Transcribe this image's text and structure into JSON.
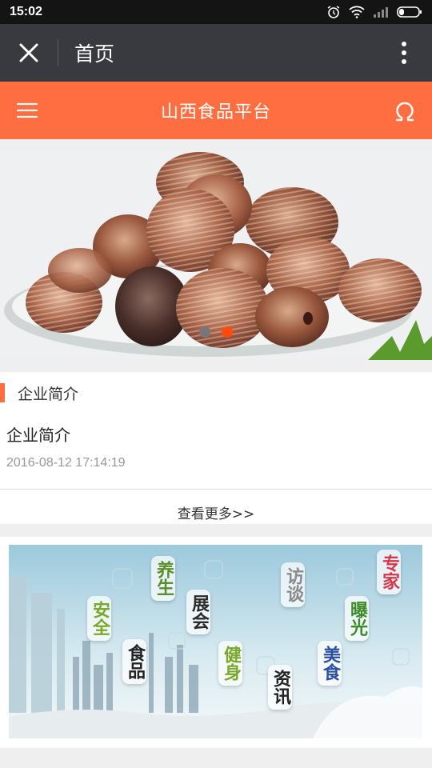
{
  "status": {
    "time": "15:02"
  },
  "titlebar": {
    "title": "首页"
  },
  "header": {
    "title": "山西食品平台"
  },
  "banner": {
    "slides": 2,
    "active_slide": 2
  },
  "intro": {
    "section_title": "企业简介",
    "item_title": "企业简介",
    "item_date": "2016-08-12 17:14:19",
    "more_label": "查看更多>>"
  },
  "promo": {
    "tags": [
      "养生",
      "展会",
      "访谈",
      "专家",
      "安全",
      "曝光",
      "健身",
      "美食",
      "食品",
      "资讯"
    ]
  },
  "colors": {
    "accent": "#ff6e40",
    "titlebar": "#393a3f",
    "active_dot": "#ff4a10"
  }
}
